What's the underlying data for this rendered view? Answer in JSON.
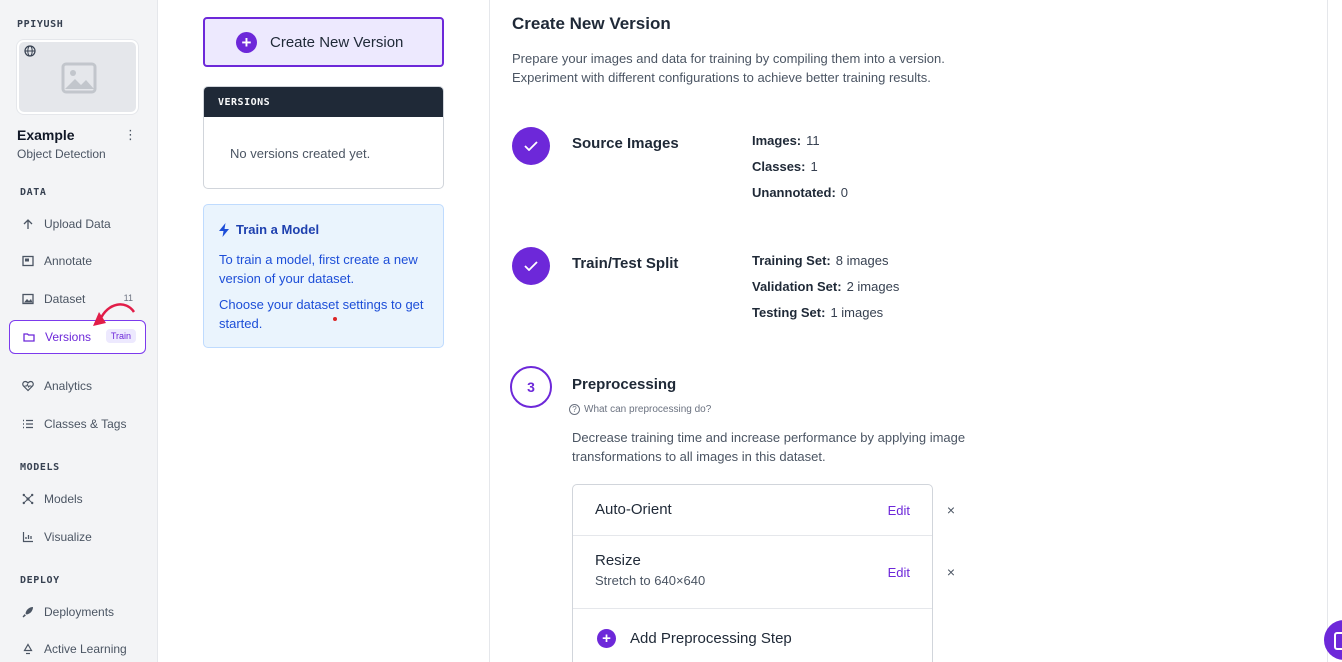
{
  "workspace": {
    "name": "PPIYUSH"
  },
  "project": {
    "name": "Example",
    "type": "Object Detection",
    "thumbnail_icon": "image-placeholder-icon",
    "visibility_icon": "globe-icon"
  },
  "sidebar": {
    "sections": {
      "data": "DATA",
      "models": "MODELS",
      "deploy": "DEPLOY"
    },
    "items": [
      {
        "label": "Upload Data",
        "icon": "upload-icon"
      },
      {
        "label": "Annotate",
        "icon": "annotate-icon"
      },
      {
        "label": "Dataset",
        "icon": "image-icon",
        "count": "11"
      },
      {
        "label": "Versions",
        "icon": "folder-icon",
        "badge": "Train",
        "active": true
      },
      {
        "label": "Analytics",
        "icon": "heart-pulse-icon"
      },
      {
        "label": "Classes & Tags",
        "icon": "list-icon"
      },
      {
        "label": "Models",
        "icon": "models-icon"
      },
      {
        "label": "Visualize",
        "icon": "chart-icon"
      },
      {
        "label": "Deployments",
        "icon": "rocket-icon"
      },
      {
        "label": "Active Learning",
        "icon": "recycle-icon"
      }
    ]
  },
  "versions_panel": {
    "create_button": "Create New Version",
    "header": "VERSIONS",
    "empty_text": "No versions created yet."
  },
  "train_card": {
    "title": "Train a Model",
    "line1": "To train a model, first create a new version of your dataset.",
    "line2": "Choose your dataset settings to get started."
  },
  "main": {
    "title": "Create New Version",
    "description_line1": "Prepare your images and data for training by compiling them into a version.",
    "description_line2": "Experiment with different configurations to achieve better training results.",
    "steps": [
      {
        "title": "Source Images",
        "done": true,
        "stats": [
          {
            "key": "Images:",
            "value": "11"
          },
          {
            "key": "Classes:",
            "value": "1"
          },
          {
            "key": "Unannotated:",
            "value": "0"
          }
        ]
      },
      {
        "title": "Train/Test Split",
        "done": true,
        "stats": [
          {
            "key": "Training Set:",
            "value": "8 images"
          },
          {
            "key": "Validation Set:",
            "value": "2 images"
          },
          {
            "key": "Testing Set:",
            "value": "1 images"
          }
        ]
      },
      {
        "number": "3",
        "title": "Preprocessing",
        "help": "What can preprocessing do?",
        "description": "Decrease training time and increase performance by applying image transformations to all images in this dataset.",
        "items": [
          {
            "name": "Auto-Orient",
            "sub": "",
            "edit": "Edit",
            "remove": "×"
          },
          {
            "name": "Resize",
            "sub": "Stretch to 640×640",
            "edit": "Edit",
            "remove": "×"
          }
        ],
        "add_label": "Add Preprocessing Step"
      }
    ]
  },
  "colors": {
    "accent": "#6d28d9",
    "accent_light": "#ede9fe",
    "info_bg": "#eaf4fd",
    "info_text": "#1d4ed8"
  }
}
